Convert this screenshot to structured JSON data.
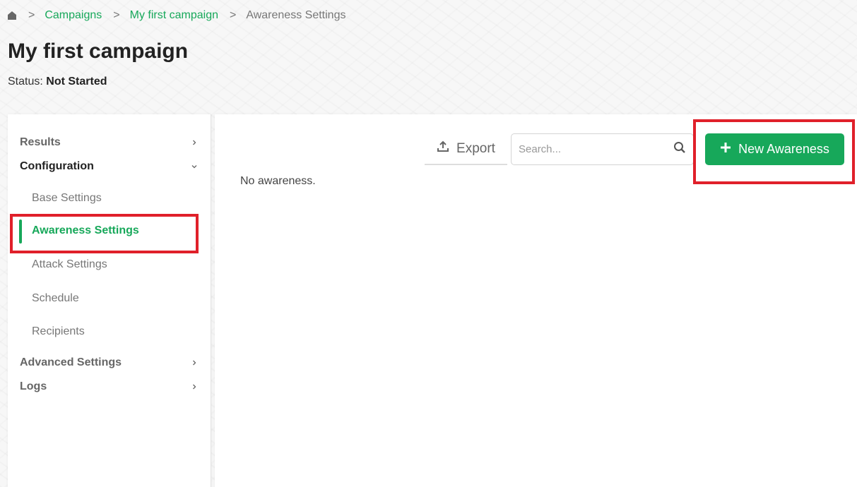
{
  "breadcrumb": {
    "home_icon": "home-icon",
    "separator": ">",
    "items": [
      "Campaigns",
      "My first campaign"
    ],
    "current": "Awareness Settings"
  },
  "page": {
    "title": "My first campaign",
    "status_label": "Status:",
    "status_value": "Not Started"
  },
  "sidebar": {
    "results": "Results",
    "configuration": "Configuration",
    "sub_items": [
      "Base Settings",
      "Awareness Settings",
      "Attack Settings",
      "Schedule",
      "Recipients"
    ],
    "active_item": "Awareness Settings",
    "advanced": "Advanced Settings",
    "logs": "Logs"
  },
  "toolbar": {
    "export_label": "Export",
    "export_icon": "upload-icon",
    "search_placeholder": "Search...",
    "search_icon": "search-icon",
    "new_label": "New Awareness",
    "new_icon": "plus-icon"
  },
  "content": {
    "empty_message": "No awareness."
  },
  "colors": {
    "accent": "#17a85a",
    "highlight": "#e0202a"
  }
}
